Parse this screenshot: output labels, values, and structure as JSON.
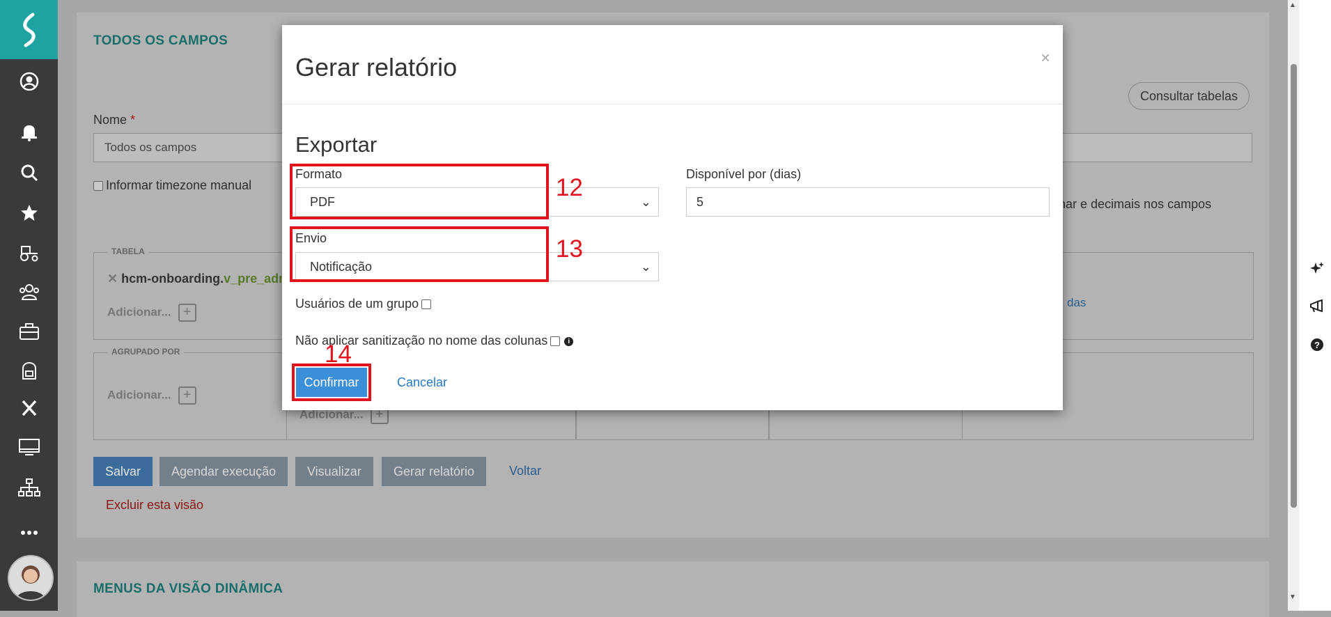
{
  "sidebar": {
    "icons": [
      "logo-icon",
      "user-circle-icon",
      "bell-icon",
      "search-icon",
      "star-icon",
      "tractor-icon",
      "team-icon",
      "briefcase-icon",
      "backpack-icon",
      "close-x-icon",
      "monitor-icon",
      "org-chart-icon",
      "more-icon"
    ]
  },
  "background": {
    "section_title": "TODOS OS CAMPOS",
    "consult_tables": "Consultar tabelas",
    "name_label": "Nome",
    "name_required": "*",
    "name_value": "Todos os campos",
    "timezone_label": "Informar timezone manual",
    "decimals_text": "nar e decimais nos campos",
    "table_legend": "TABELA",
    "table_item_prefix": "hcm-onboarding.",
    "table_item_suffix": "v_pre_adn",
    "add_label": "Adicionar...",
    "link_fragment": "das",
    "grouped_legend": "AGRUPADO POR",
    "buttons": {
      "save": "Salvar",
      "schedule": "Agendar execução",
      "view": "Visualizar",
      "generate": "Gerar relatório",
      "back": "Voltar"
    },
    "delete_view": "Excluir esta visão",
    "menus_title": "MENUS DA VISÃO DINÂMICA"
  },
  "modal": {
    "title": "Gerar relatório",
    "close": "×",
    "export_heading": "Exportar",
    "format_label": "Formato",
    "format_value": "PDF",
    "available_label": "Disponível por (dias)",
    "available_value": "5",
    "send_label": "Envio",
    "send_value": "Notificação",
    "group_users_label": "Usuários de um grupo",
    "no_sanitize_label": "Não aplicar sanitização no nome das colunas",
    "confirm": "Confirmar",
    "cancel": "Cancelar"
  },
  "annotations": {
    "format": "12",
    "send": "13",
    "confirm": "14",
    "color": "#e0141e"
  },
  "right_rail": {
    "icons": [
      "sparkle-icon",
      "megaphone-icon",
      "help-icon"
    ]
  }
}
